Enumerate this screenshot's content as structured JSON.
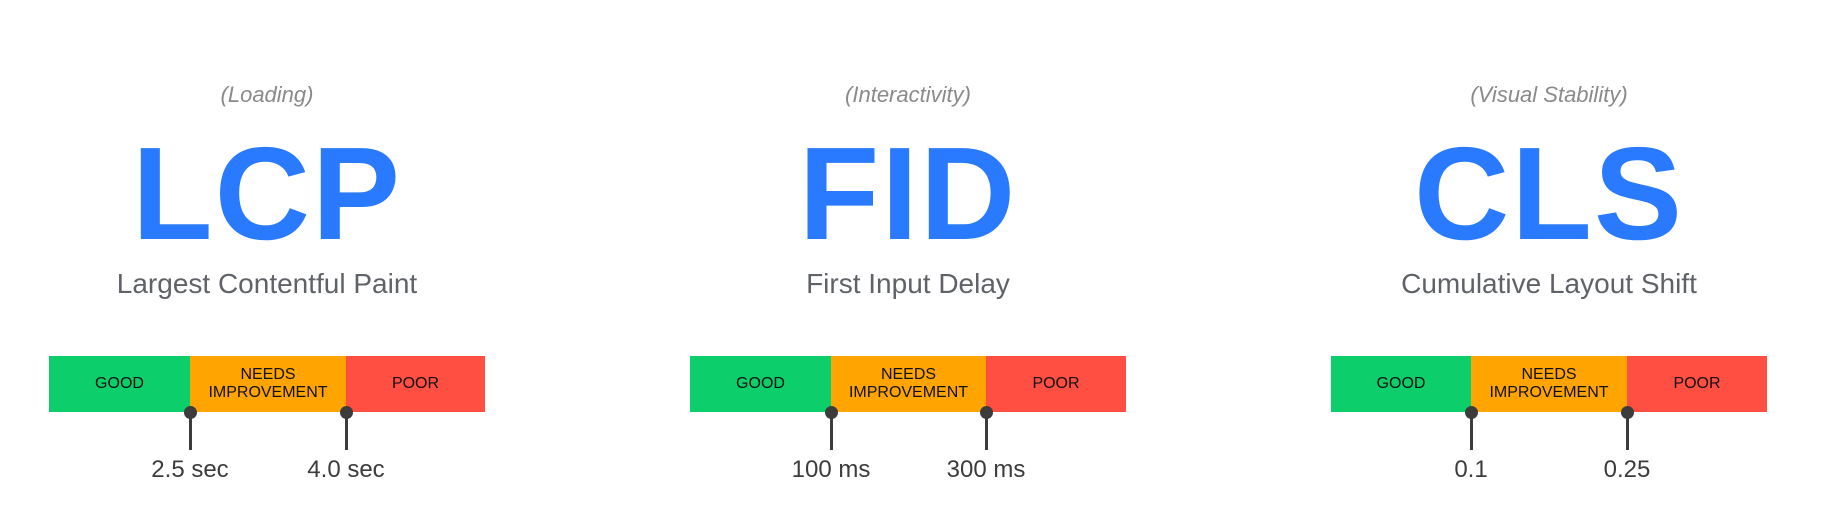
{
  "colors": {
    "accent": "#2a7aff",
    "good": "#0cce6b",
    "needs_improvement": "#ffa400",
    "poor": "#ff4e42"
  },
  "metrics": [
    {
      "category": "(Loading)",
      "abbr": "LCP",
      "name": "Largest Contentful Paint",
      "good": "GOOD",
      "needs_improvement": "NEEDS IMPROVEMENT",
      "poor": "POOR",
      "threshold_good": "2.5 sec",
      "threshold_poor": "4.0 sec"
    },
    {
      "category": "(Interactivity)",
      "abbr": "FID",
      "name": "First Input Delay",
      "good": "GOOD",
      "needs_improvement": "NEEDS IMPROVEMENT",
      "poor": "POOR",
      "threshold_good": "100 ms",
      "threshold_poor": "300 ms"
    },
    {
      "category": "(Visual Stability)",
      "abbr": "CLS",
      "name": "Cumulative Layout Shift",
      "good": "GOOD",
      "needs_improvement": "NEEDS IMPROVEMENT",
      "poor": "POOR",
      "threshold_good": "0.1",
      "threshold_poor": "0.25"
    }
  ]
}
